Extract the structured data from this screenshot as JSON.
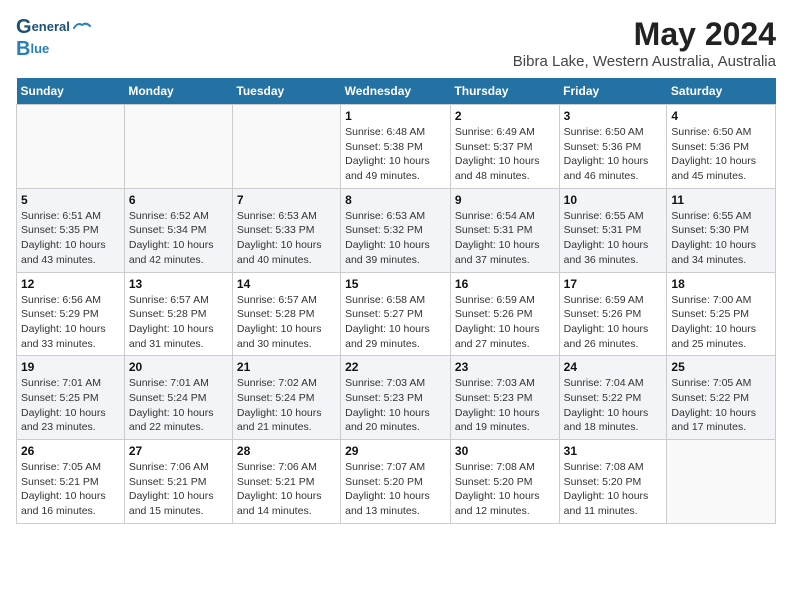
{
  "header": {
    "logo_line1": "General",
    "logo_line2": "Blue",
    "title": "May 2024",
    "subtitle": "Bibra Lake, Western Australia, Australia"
  },
  "days_of_week": [
    "Sunday",
    "Monday",
    "Tuesday",
    "Wednesday",
    "Thursday",
    "Friday",
    "Saturday"
  ],
  "weeks": [
    [
      {
        "day": "",
        "info": ""
      },
      {
        "day": "",
        "info": ""
      },
      {
        "day": "",
        "info": ""
      },
      {
        "day": "1",
        "info": "Sunrise: 6:48 AM\nSunset: 5:38 PM\nDaylight: 10 hours\nand 49 minutes."
      },
      {
        "day": "2",
        "info": "Sunrise: 6:49 AM\nSunset: 5:37 PM\nDaylight: 10 hours\nand 48 minutes."
      },
      {
        "day": "3",
        "info": "Sunrise: 6:50 AM\nSunset: 5:36 PM\nDaylight: 10 hours\nand 46 minutes."
      },
      {
        "day": "4",
        "info": "Sunrise: 6:50 AM\nSunset: 5:36 PM\nDaylight: 10 hours\nand 45 minutes."
      }
    ],
    [
      {
        "day": "5",
        "info": "Sunrise: 6:51 AM\nSunset: 5:35 PM\nDaylight: 10 hours\nand 43 minutes."
      },
      {
        "day": "6",
        "info": "Sunrise: 6:52 AM\nSunset: 5:34 PM\nDaylight: 10 hours\nand 42 minutes."
      },
      {
        "day": "7",
        "info": "Sunrise: 6:53 AM\nSunset: 5:33 PM\nDaylight: 10 hours\nand 40 minutes."
      },
      {
        "day": "8",
        "info": "Sunrise: 6:53 AM\nSunset: 5:32 PM\nDaylight: 10 hours\nand 39 minutes."
      },
      {
        "day": "9",
        "info": "Sunrise: 6:54 AM\nSunset: 5:31 PM\nDaylight: 10 hours\nand 37 minutes."
      },
      {
        "day": "10",
        "info": "Sunrise: 6:55 AM\nSunset: 5:31 PM\nDaylight: 10 hours\nand 36 minutes."
      },
      {
        "day": "11",
        "info": "Sunrise: 6:55 AM\nSunset: 5:30 PM\nDaylight: 10 hours\nand 34 minutes."
      }
    ],
    [
      {
        "day": "12",
        "info": "Sunrise: 6:56 AM\nSunset: 5:29 PM\nDaylight: 10 hours\nand 33 minutes."
      },
      {
        "day": "13",
        "info": "Sunrise: 6:57 AM\nSunset: 5:28 PM\nDaylight: 10 hours\nand 31 minutes."
      },
      {
        "day": "14",
        "info": "Sunrise: 6:57 AM\nSunset: 5:28 PM\nDaylight: 10 hours\nand 30 minutes."
      },
      {
        "day": "15",
        "info": "Sunrise: 6:58 AM\nSunset: 5:27 PM\nDaylight: 10 hours\nand 29 minutes."
      },
      {
        "day": "16",
        "info": "Sunrise: 6:59 AM\nSunset: 5:26 PM\nDaylight: 10 hours\nand 27 minutes."
      },
      {
        "day": "17",
        "info": "Sunrise: 6:59 AM\nSunset: 5:26 PM\nDaylight: 10 hours\nand 26 minutes."
      },
      {
        "day": "18",
        "info": "Sunrise: 7:00 AM\nSunset: 5:25 PM\nDaylight: 10 hours\nand 25 minutes."
      }
    ],
    [
      {
        "day": "19",
        "info": "Sunrise: 7:01 AM\nSunset: 5:25 PM\nDaylight: 10 hours\nand 23 minutes."
      },
      {
        "day": "20",
        "info": "Sunrise: 7:01 AM\nSunset: 5:24 PM\nDaylight: 10 hours\nand 22 minutes."
      },
      {
        "day": "21",
        "info": "Sunrise: 7:02 AM\nSunset: 5:24 PM\nDaylight: 10 hours\nand 21 minutes."
      },
      {
        "day": "22",
        "info": "Sunrise: 7:03 AM\nSunset: 5:23 PM\nDaylight: 10 hours\nand 20 minutes."
      },
      {
        "day": "23",
        "info": "Sunrise: 7:03 AM\nSunset: 5:23 PM\nDaylight: 10 hours\nand 19 minutes."
      },
      {
        "day": "24",
        "info": "Sunrise: 7:04 AM\nSunset: 5:22 PM\nDaylight: 10 hours\nand 18 minutes."
      },
      {
        "day": "25",
        "info": "Sunrise: 7:05 AM\nSunset: 5:22 PM\nDaylight: 10 hours\nand 17 minutes."
      }
    ],
    [
      {
        "day": "26",
        "info": "Sunrise: 7:05 AM\nSunset: 5:21 PM\nDaylight: 10 hours\nand 16 minutes."
      },
      {
        "day": "27",
        "info": "Sunrise: 7:06 AM\nSunset: 5:21 PM\nDaylight: 10 hours\nand 15 minutes."
      },
      {
        "day": "28",
        "info": "Sunrise: 7:06 AM\nSunset: 5:21 PM\nDaylight: 10 hours\nand 14 minutes."
      },
      {
        "day": "29",
        "info": "Sunrise: 7:07 AM\nSunset: 5:20 PM\nDaylight: 10 hours\nand 13 minutes."
      },
      {
        "day": "30",
        "info": "Sunrise: 7:08 AM\nSunset: 5:20 PM\nDaylight: 10 hours\nand 12 minutes."
      },
      {
        "day": "31",
        "info": "Sunrise: 7:08 AM\nSunset: 5:20 PM\nDaylight: 10 hours\nand 11 minutes."
      },
      {
        "day": "",
        "info": ""
      }
    ]
  ]
}
